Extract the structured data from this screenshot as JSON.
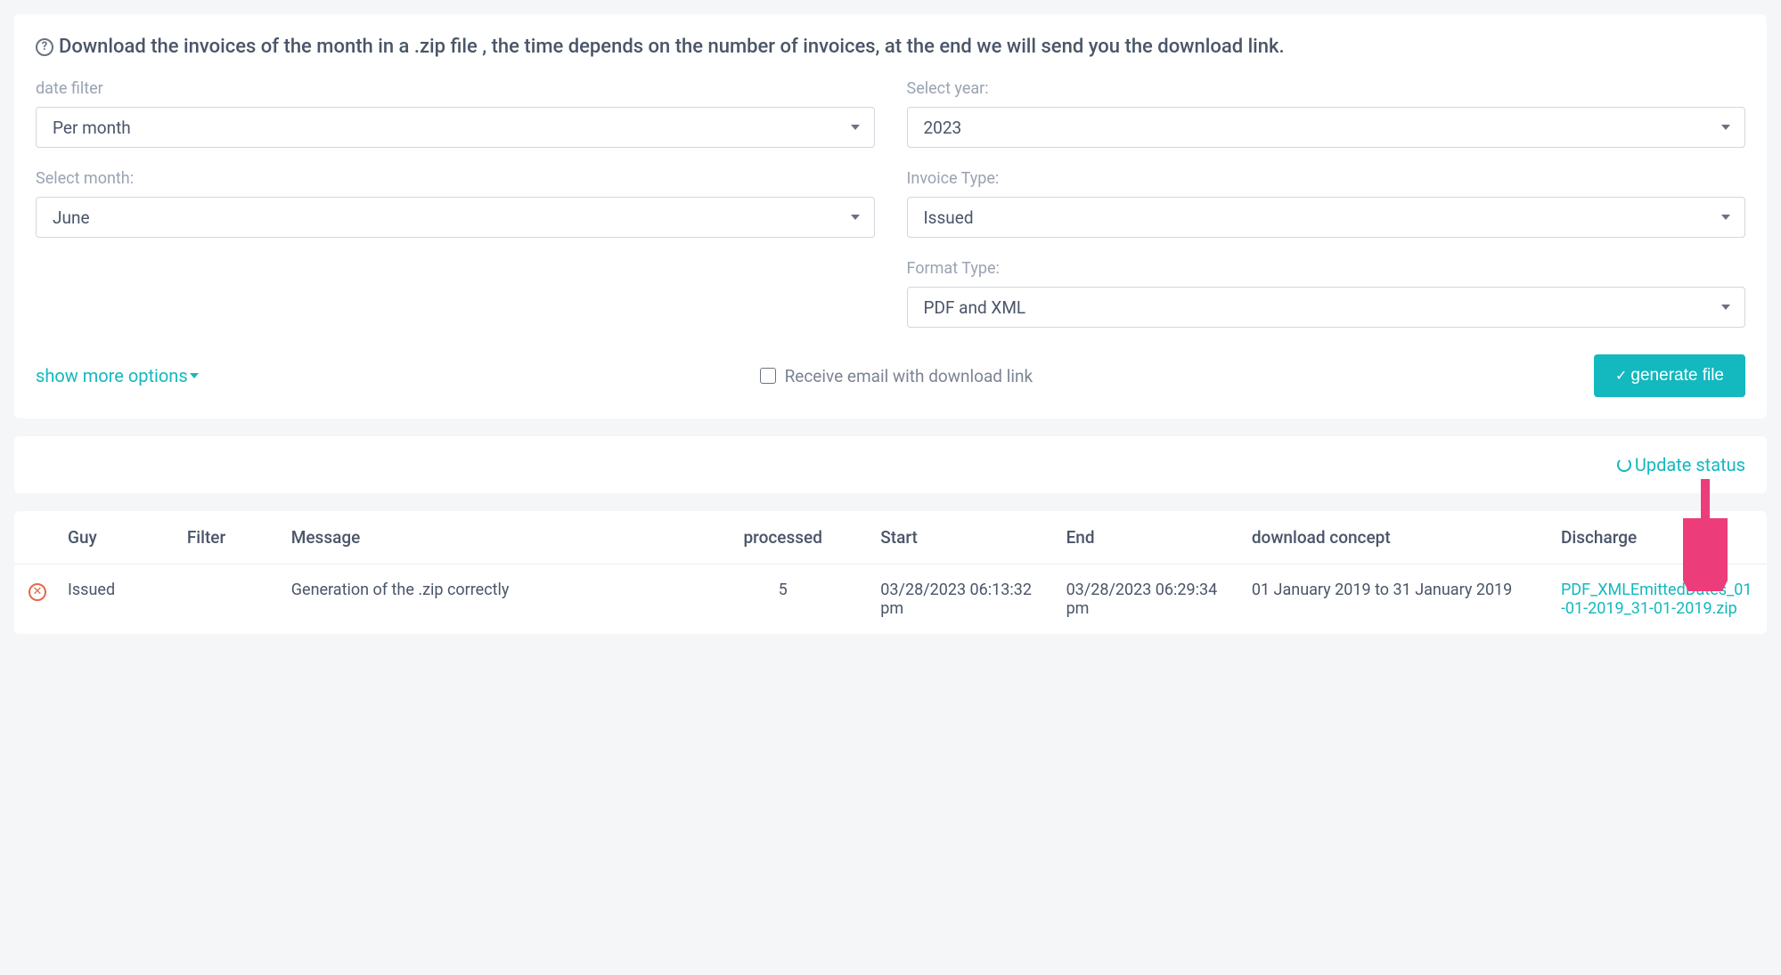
{
  "info_text": "Download the invoices of the month in a .zip file , the time depends on the number of invoices, at the end we will send you the download link.",
  "filters": {
    "date_filter": {
      "label": "date filter",
      "value": "Per month"
    },
    "select_year": {
      "label": "Select year:",
      "value": "2023"
    },
    "select_month": {
      "label": "Select month:",
      "value": "June"
    },
    "invoice_type": {
      "label": "Invoice Type:",
      "value": "Issued"
    },
    "format_type": {
      "label": "Format Type:",
      "value": "PDF and XML"
    }
  },
  "show_more_label": "show more options",
  "email_checkbox_label": "Receive email with download link",
  "generate_label": "generate file",
  "update_status_label": "Update status",
  "table": {
    "headers": {
      "guy": "Guy",
      "filter": "Filter",
      "message": "Message",
      "processed": "processed",
      "start": "Start",
      "end": "End",
      "concept": "download concept",
      "discharge": "Discharge"
    },
    "row": {
      "guy": "Issued",
      "filter": "",
      "message": "Generation of the .zip correctly",
      "processed": "5",
      "start": "03/28/2023 06:13:32 pm",
      "end": "03/28/2023 06:29:34 pm",
      "concept": "01 January 2019 to 31 January 2019",
      "discharge": "PDF_XMLEmittedDates_01-01-2019_31-01-2019.zip"
    }
  }
}
